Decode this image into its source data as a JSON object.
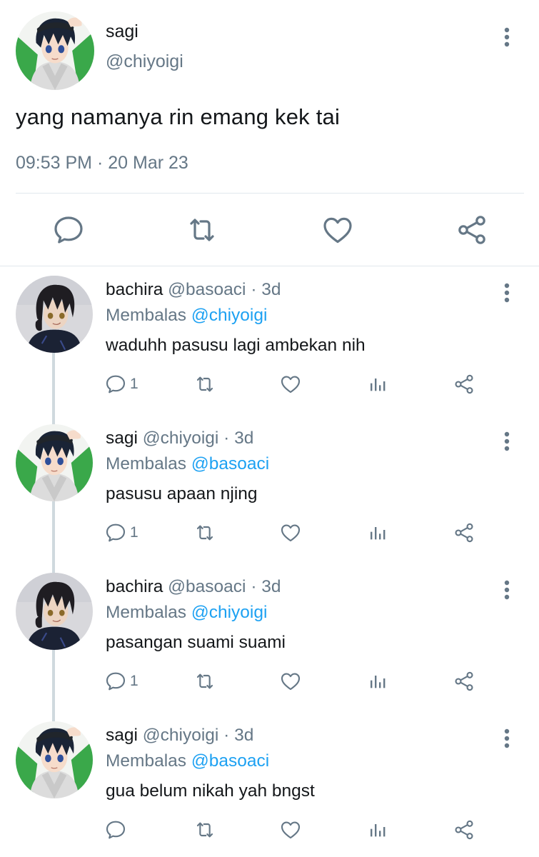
{
  "colors": {
    "accent": "#1da1f2",
    "muted": "#657786",
    "text": "#14171a",
    "divider": "#e1e8ed"
  },
  "main_tweet": {
    "name": "sagi",
    "handle": "@chiyoigi",
    "text": "yang namanya rin emang kek tai",
    "time": "09:53 PM",
    "separator": "·",
    "date": "20 Mar 23",
    "actions": [
      "reply-icon",
      "retweet-icon",
      "like-icon",
      "share-icon"
    ]
  },
  "replies": [
    {
      "name": "bachira",
      "handle": "@basoaci",
      "separator": "·",
      "age": "3d",
      "replying_label": "Membalas",
      "mention": "@chiyoigi",
      "text": "waduhh pasusu lagi ambekan nih",
      "reply_count": "1"
    },
    {
      "name": "sagi",
      "handle": "@chiyoigi",
      "separator": "·",
      "age": "3d",
      "replying_label": "Membalas",
      "mention": "@basoaci",
      "text": "pasusu apaan njing",
      "reply_count": "1"
    },
    {
      "name": "bachira",
      "handle": "@basoaci",
      "separator": "·",
      "age": "3d",
      "replying_label": "Membalas",
      "mention": "@chiyoigi",
      "text": "pasangan suami suami",
      "reply_count": "1"
    },
    {
      "name": "sagi",
      "handle": "@chiyoigi",
      "separator": "·",
      "age": "3d",
      "replying_label": "Membalas",
      "mention": "@basoaci",
      "text": "gua belum nikah yah bngst",
      "reply_count": ""
    }
  ]
}
